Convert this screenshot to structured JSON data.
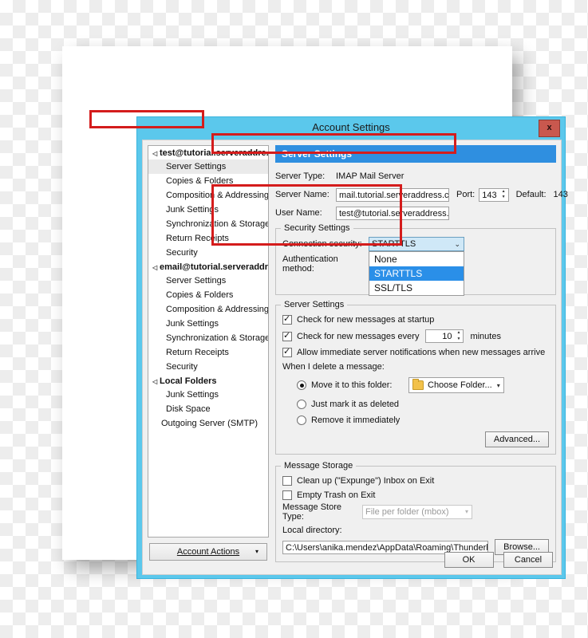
{
  "window": {
    "title": "Account Settings",
    "close_label": "x"
  },
  "sidebar": {
    "accounts": [
      {
        "name": "test@tutorial.serveraddre...",
        "items": [
          "Server Settings",
          "Copies & Folders",
          "Composition & Addressing",
          "Junk Settings",
          "Synchronization & Storage",
          "Return Receipts",
          "Security"
        ],
        "selected": "Server Settings"
      },
      {
        "name": "email@tutorial.serveraddres...",
        "items": [
          "Server Settings",
          "Copies & Folders",
          "Composition & Addressing",
          "Junk Settings",
          "Synchronization & Storage",
          "Return Receipts",
          "Security"
        ],
        "selected": null
      },
      {
        "name": "Local Folders",
        "items": [
          "Junk Settings",
          "Disk Space"
        ],
        "selected": null
      }
    ],
    "outgoing_server": "Outgoing Server (SMTP)",
    "account_actions_label": "Account Actions",
    "account_actions_caret": "▾"
  },
  "pane": {
    "banner_title": "Server Settings",
    "server_type_label": "Server Type:",
    "server_type_value": "IMAP Mail Server",
    "server_name_label": "Server Name:",
    "server_name_value": "mail.tutorial.serveraddress.c",
    "port_label": "Port:",
    "port_value": "143",
    "default_label": "Default:",
    "default_value": "143",
    "user_name_label": "User Name:",
    "user_name_value": "test@tutorial.serveraddress."
  },
  "security_settings": {
    "group_title": "Security Settings",
    "connection_security_label": "Connection security:",
    "connection_security_value": "STARTTLS",
    "connection_security_options": [
      "None",
      "STARTTLS",
      "SSL/TLS"
    ],
    "connection_security_highlighted": "STARTTLS",
    "authentication_method_label": "Authentication method:"
  },
  "server_settings_group": {
    "group_title": "Server Settings",
    "check_startup_label": "Check for new messages at startup",
    "check_startup_checked": true,
    "check_every_label": "Check for new messages every",
    "check_every_value": "10",
    "minutes_label": "minutes",
    "check_every_checked": true,
    "allow_notifications_label": "Allow immediate server notifications when new messages arrive",
    "allow_notifications_checked": true,
    "delete_prompt": "When I delete a message:",
    "delete_options": [
      {
        "label": "Move it to this folder:",
        "selected": true
      },
      {
        "label": "Just mark it as deleted",
        "selected": false
      },
      {
        "label": "Remove it immediately",
        "selected": false
      }
    ],
    "choose_folder_label": "Choose Folder...",
    "choose_folder_chevron": "▾",
    "advanced_label": "Advanced..."
  },
  "message_storage": {
    "group_title": "Message Storage",
    "expunge_label": "Clean up (\"Expunge\") Inbox on Exit",
    "expunge_checked": false,
    "empty_trash_label": "Empty Trash on Exit",
    "empty_trash_checked": false,
    "store_type_label": "Message Store Type:",
    "store_type_value": "File per folder (mbox)",
    "store_type_chevron": "▾",
    "local_dir_label": "Local directory:",
    "local_dir_value": "C:\\Users\\anika.mendez\\AppData\\Roaming\\Thunderbird\\Pr",
    "browse_label": "Browse..."
  },
  "footer": {
    "ok_label": "OK",
    "cancel_label": "Cancel"
  },
  "annotations": {
    "accent_red": "#d41c1c",
    "banner_blue": "#2f8fe0",
    "titlebar_blue": "#5bc8ec",
    "highlight_blue": "#2a8fe8"
  }
}
